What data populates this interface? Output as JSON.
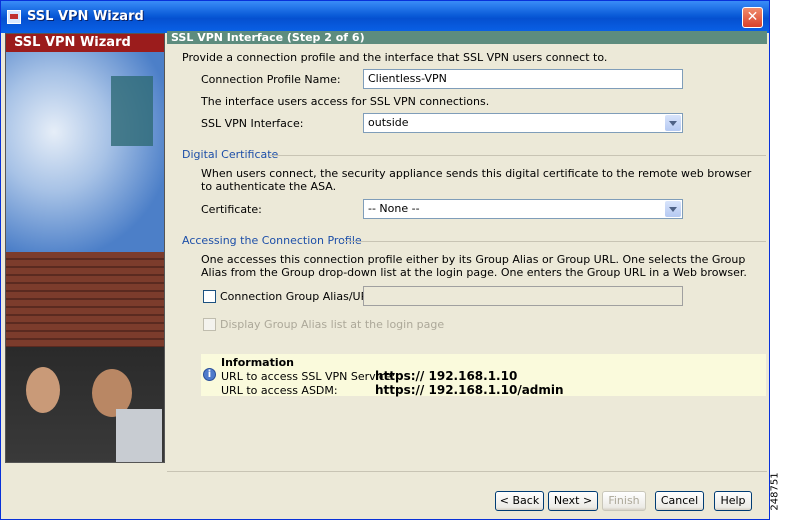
{
  "window": {
    "title": "SSL VPN Wizard",
    "close_glyph": "✕"
  },
  "left_panel": {
    "banner": "SSL VPN Wizard"
  },
  "step_header": "SSL VPN Interface  (Step 2 of 6)",
  "intro_text": "Provide a connection profile and the interface that SSL VPN users connect to.",
  "connection_profile": {
    "label": "Connection Profile Name:",
    "value": "Clientless-VPN"
  },
  "interface_note": "The interface users access for SSL VPN connections.",
  "ssl_interface": {
    "label": "SSL VPN Interface:",
    "value": "outside"
  },
  "digital_certificate": {
    "group_title": "Digital Certificate",
    "description": "When users connect, the security appliance sends this digital certificate to the remote web browser to authenticate the ASA.",
    "label": "Certificate:",
    "value": "-- None --"
  },
  "accessing_profile": {
    "group_title": "Accessing the Connection Profile",
    "description": "One accesses this connection profile either by its Group Alias or Group URL. One selects the Group Alias from the Group drop-down list at the login page. One enters the Group URL in a Web browser.",
    "alias_checkbox_label": "Connection Group Alias/URL",
    "alias_value": "",
    "display_checkbox_label": "Display Group Alias list at the login page"
  },
  "information": {
    "icon_glyph": "i",
    "title": "Information",
    "ssl_label": "URL to access SSL VPN Service:",
    "ssl_url": "https:// 192.168.1.10",
    "asdm_label": "URL to access ASDM:",
    "asdm_url": "https:// 192.168.1.10/admin"
  },
  "buttons": {
    "back": "< Back",
    "next": "Next >",
    "finish": "Finish",
    "cancel": "Cancel",
    "help": "Help"
  },
  "side_number": "248751"
}
